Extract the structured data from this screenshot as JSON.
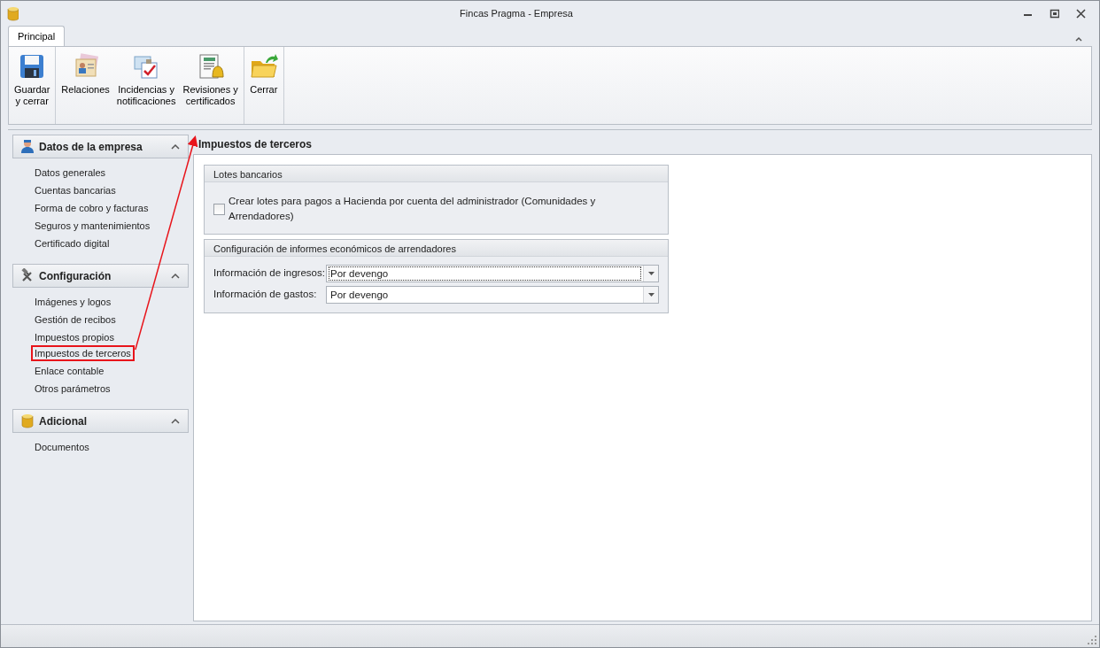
{
  "window": {
    "title": "Fincas Pragma - Empresa"
  },
  "tabs": [
    {
      "label": "Principal",
      "selected": true
    }
  ],
  "ribbon": [
    {
      "kind": "save",
      "label": "Guardar\ny cerrar"
    },
    {
      "kind": "cards",
      "label": "Relaciones"
    },
    {
      "kind": "mail",
      "label": "Incidencias y\nnotificaciones"
    },
    {
      "kind": "bell",
      "label": "Revisiones y\ncertificados"
    },
    {
      "kind": "folder",
      "label": "Cerrar"
    }
  ],
  "sidebar": {
    "groups": [
      {
        "kind": "person",
        "title": "Datos de la empresa",
        "expanded": true,
        "items": [
          {
            "label": "Datos generales",
            "selected": false
          },
          {
            "label": "Cuentas bancarias",
            "selected": false
          },
          {
            "label": "Forma de cobro y facturas",
            "selected": false
          },
          {
            "label": "Seguros y mantenimientos",
            "selected": false
          },
          {
            "label": "Certificado digital",
            "selected": false
          }
        ]
      },
      {
        "kind": "tools",
        "title": "Configuración",
        "expanded": true,
        "items": [
          {
            "label": "Imágenes y logos",
            "selected": false
          },
          {
            "label": "Gestión de recibos",
            "selected": false
          },
          {
            "label": "Impuestos propios",
            "selected": false
          },
          {
            "label": "Impuestos de terceros",
            "selected": true
          },
          {
            "label": "Enlace contable",
            "selected": false
          },
          {
            "label": "Otros parámetros",
            "selected": false
          }
        ]
      },
      {
        "kind": "db",
        "title": "Adicional",
        "expanded": true,
        "items": [
          {
            "label": "Documentos",
            "selected": false
          }
        ]
      }
    ]
  },
  "content": {
    "title": "Impuestos de terceros",
    "sections": [
      {
        "title": "Lotes bancarios",
        "fields": [
          {
            "kind": "checkbox",
            "label": "Crear lotes para pagos a Hacienda por cuenta del administrador (Comunidades y Arrendadores)",
            "checked": false
          }
        ]
      },
      {
        "title": "Configuración de informes económicos de arrendadores",
        "fields": [
          {
            "kind": "select",
            "label": "Información de ingresos:",
            "value": "Por devengo",
            "focused": true
          },
          {
            "kind": "select",
            "label": "Información de gastos:",
            "value": "Por devengo",
            "focused": false
          }
        ]
      }
    ]
  }
}
